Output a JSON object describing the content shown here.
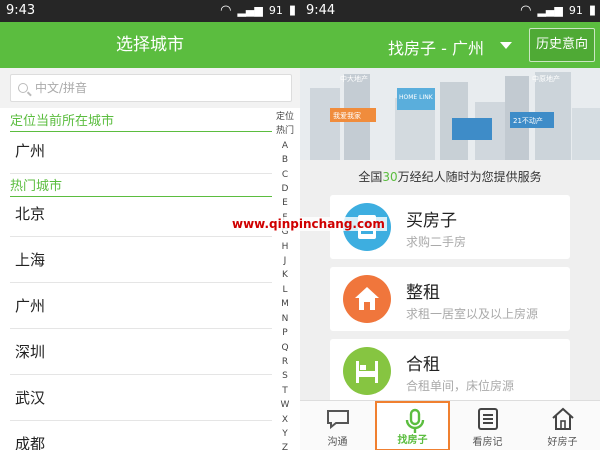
{
  "left": {
    "status": {
      "time": "9:43",
      "battery": "91"
    },
    "title": "选择城市",
    "search": {
      "placeholder": "中文/拼音"
    },
    "locate_section": "定位当前所在城市",
    "current_city": "广州",
    "hot_section": "热门城市",
    "hot_cities": [
      "北京",
      "上海",
      "广州",
      "深圳",
      "武汉",
      "成都"
    ],
    "index": [
      "定位",
      "热门",
      "A",
      "B",
      "C",
      "D",
      "E",
      "F",
      "G",
      "H",
      "J",
      "K",
      "L",
      "M",
      "N",
      "P",
      "Q",
      "R",
      "S",
      "T",
      "W",
      "X",
      "Y",
      "Z"
    ]
  },
  "right": {
    "status": {
      "time": "9:44",
      "battery": "91"
    },
    "title": "找房子 - 广州",
    "history_button": "历史意向",
    "skyline_labels": [
      "中大地产",
      "HOME LINK",
      "中原地产",
      "我爱我家",
      "21不动产"
    ],
    "tagline_prefix": "全国",
    "tagline_number": "30",
    "tagline_suffix": "万经纪人随时为您提供服务",
    "cards": [
      {
        "title": "买房子",
        "subtitle": "求购二手房",
        "color": "#3daee0"
      },
      {
        "title": "整租",
        "subtitle": "求租一居室以及以上房源",
        "color": "#f0763c"
      },
      {
        "title": "合租",
        "subtitle": "合租单间，床位房源",
        "color": "#86c541"
      }
    ],
    "tabs": [
      {
        "label": "沟通",
        "icon": "chat-icon"
      },
      {
        "label": "找房子",
        "icon": "microphone-icon"
      },
      {
        "label": "看房记",
        "icon": "notebook-icon"
      },
      {
        "label": "好房子",
        "icon": "house-icon"
      }
    ]
  },
  "watermark": "www.qinpinchang.com",
  "colors": {
    "brand_green": "#5bbd3f",
    "active_tab_border": "#f08030"
  }
}
